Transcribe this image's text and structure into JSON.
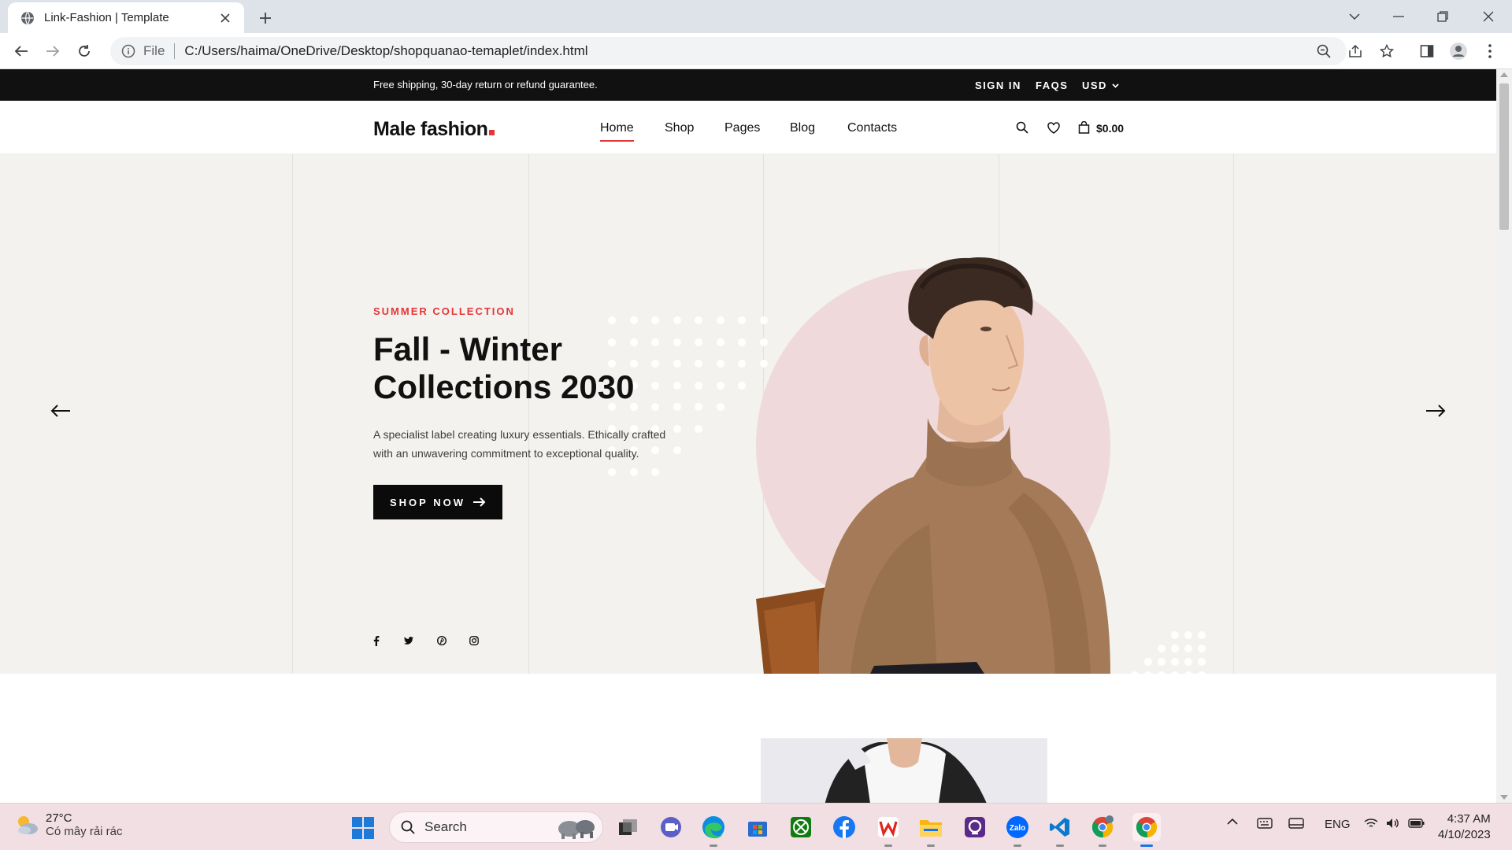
{
  "browser": {
    "tab_title": "Link-Fashion | Template",
    "url_scheme": "File",
    "url": "C:/Users/haima/OneDrive/Desktop/shopquanao-temaplet/index.html"
  },
  "offer_bar": {
    "text": "Free shipping, 30-day return or refund guarantee.",
    "sign_in": "SIGN IN",
    "faqs": "FAQS",
    "currency": "USD"
  },
  "header": {
    "logo": "Male fashion",
    "nav": [
      "Home",
      "Shop",
      "Pages",
      "Blog",
      "Contacts"
    ],
    "active_nav": "Home",
    "cart_price": "$0.00"
  },
  "hero": {
    "label": "SUMMER COLLECTION",
    "title": "Fall - Winter Collections 2030",
    "description": "A specialist label creating luxury essentials. Ethically crafted with an unwavering commitment to exceptional quality.",
    "button": "SHOP NOW",
    "social_icons": [
      "facebook-icon",
      "twitter-icon",
      "pinterest-icon",
      "instagram-icon"
    ]
  },
  "colors": {
    "accent": "#e53637",
    "hero_bg": "#f3f2ee",
    "circle": "#f0d9da",
    "dark": "#111111"
  },
  "taskbar": {
    "temperature": "27°C",
    "weather": "Có mây rải rác",
    "search": "Search",
    "language": "ENG",
    "time": "4:37 AM",
    "date": "4/10/2023"
  }
}
